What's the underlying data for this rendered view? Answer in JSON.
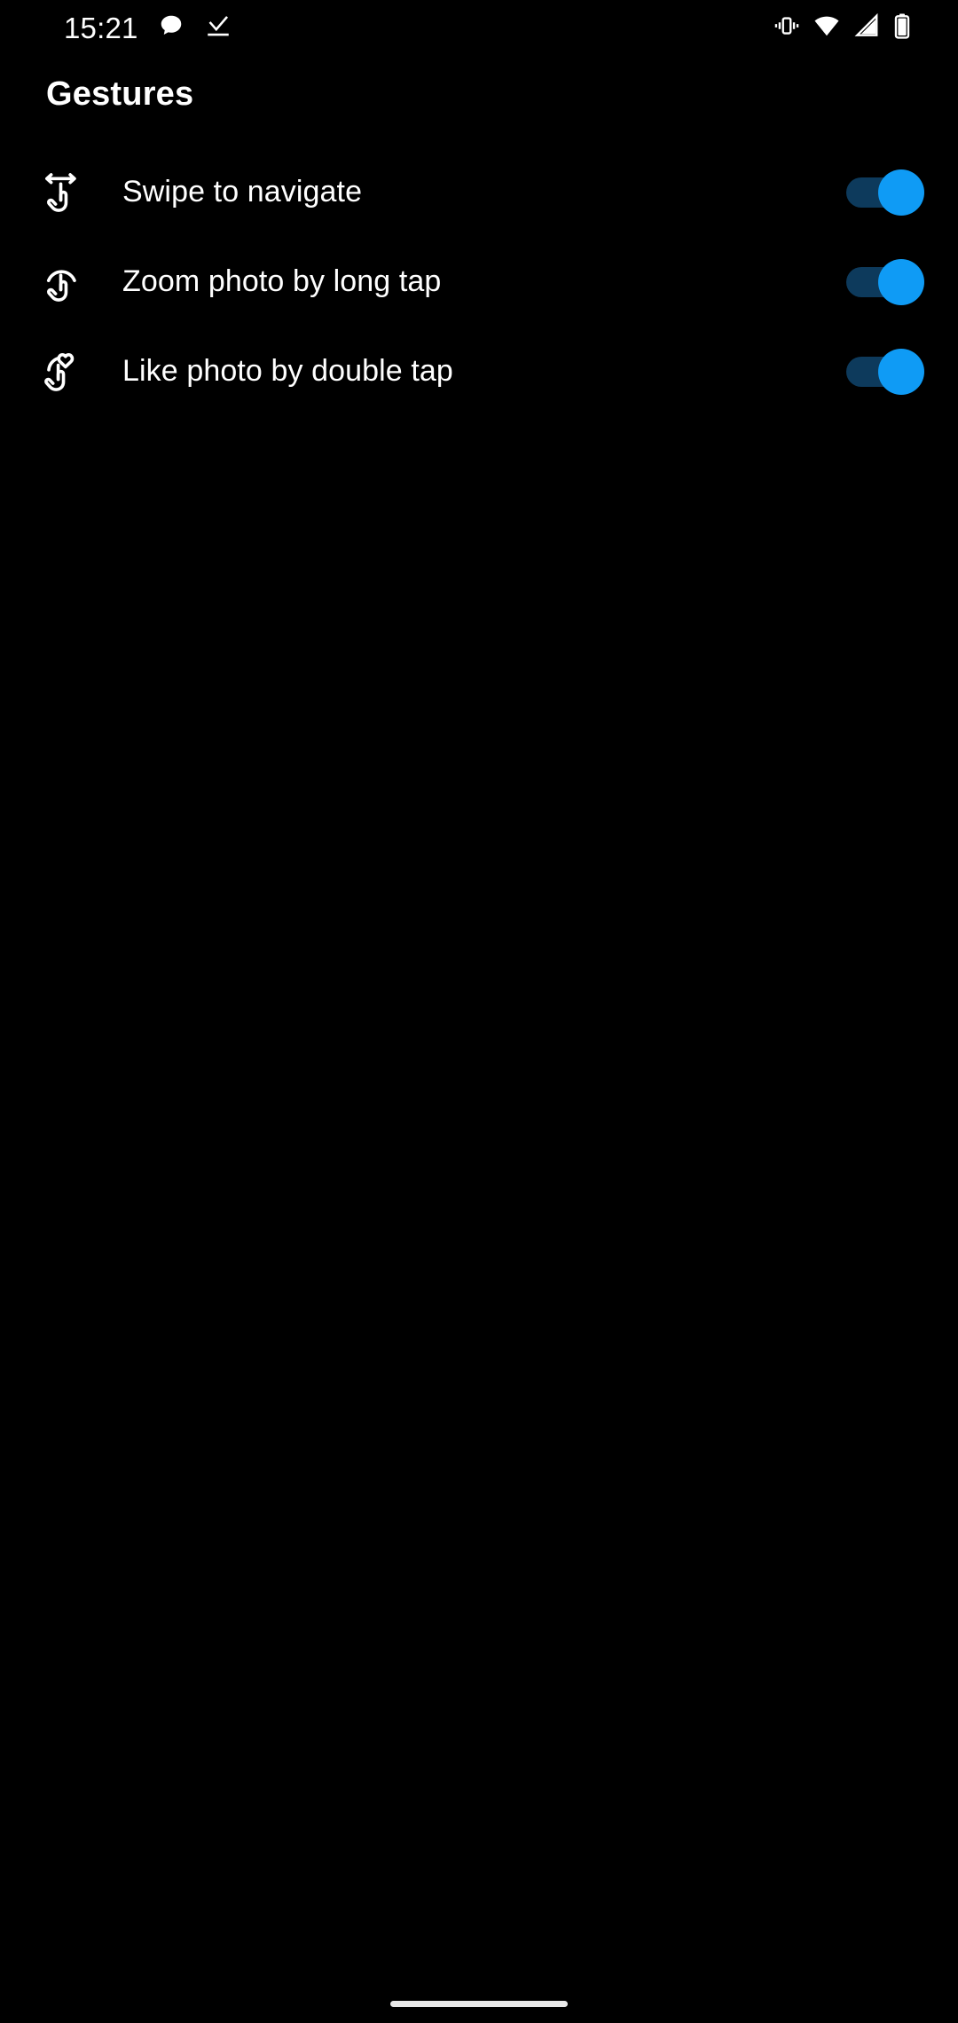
{
  "status_bar": {
    "time": "15:21",
    "left_icons": [
      {
        "name": "message-bubble-icon",
        "label": "Messages"
      },
      {
        "name": "download-complete-icon",
        "label": "Download complete"
      }
    ],
    "right_icons": [
      {
        "name": "vibrate-icon",
        "label": "Vibrate mode"
      },
      {
        "name": "wifi-icon",
        "label": "Wi-Fi full signal"
      },
      {
        "name": "cellular-signal-icon",
        "label": "Cellular signal"
      },
      {
        "name": "battery-icon",
        "label": "Battery"
      }
    ]
  },
  "header": {
    "title": "Gestures"
  },
  "settings": {
    "rows": [
      {
        "label": "Swipe to navigate",
        "icon": "swipe-horizontal-icon",
        "toggle_state": "on",
        "toggle_label": "On"
      },
      {
        "label": "Zoom photo by long tap",
        "icon": "long-tap-icon",
        "toggle_state": "on",
        "toggle_label": "On"
      },
      {
        "label": "Like photo by double tap",
        "icon": "tap-heart-icon",
        "toggle_state": "on",
        "toggle_label": "On"
      }
    ]
  },
  "navigation": {
    "home_pill": "Home gesture bar"
  },
  "colors": {
    "background": "#000000",
    "text_primary": "#ffffff",
    "toggle_thumb_on": "#0f9bf5",
    "toggle_track_on": "#0d3a5c",
    "nav_pill": "#e8e8e8"
  }
}
